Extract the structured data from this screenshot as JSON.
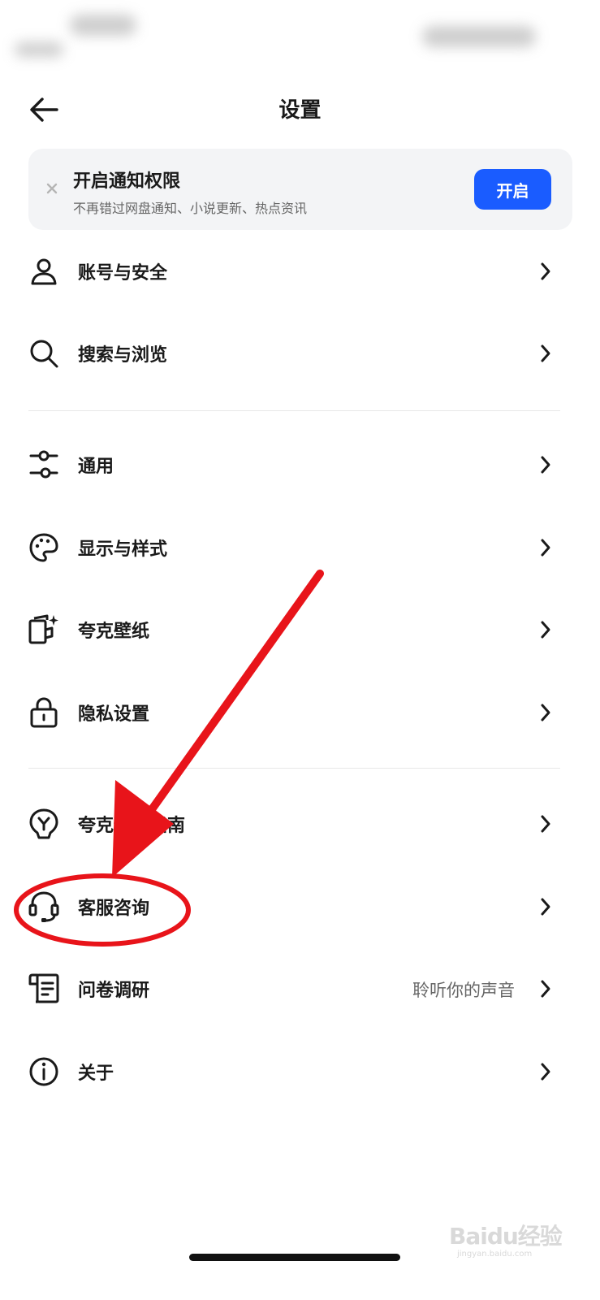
{
  "header": {
    "title": "设置"
  },
  "banner": {
    "title": "开启通知权限",
    "subtitle": "不再错过网盘通知、小说更新、热点资讯",
    "button_label": "开启"
  },
  "sections": [
    {
      "items": [
        {
          "label": "账号与安全",
          "icon": "user-icon"
        },
        {
          "label": "搜索与浏览",
          "icon": "search-icon"
        }
      ]
    },
    {
      "items": [
        {
          "label": "通用",
          "icon": "sliders-icon"
        },
        {
          "label": "显示与样式",
          "icon": "palette-icon"
        },
        {
          "label": "夸克壁纸",
          "icon": "wallpaper-icon"
        },
        {
          "label": "隐私设置",
          "icon": "lock-icon"
        }
      ]
    },
    {
      "items": [
        {
          "label": "夸克使用指南",
          "icon": "bulb-icon"
        },
        {
          "label": "客服咨询",
          "icon": "headset-icon"
        },
        {
          "label": "问卷调研",
          "icon": "survey-icon",
          "extra": "聆听你的声音"
        },
        {
          "label": "关于",
          "icon": "info-icon"
        }
      ]
    }
  ],
  "watermark": {
    "text": "Baidu经验",
    "sub": "jingyan.baidu.com"
  },
  "colors": {
    "accent": "#1a5cff",
    "annotation": "#e8141a",
    "banner_bg": "#f3f4f6"
  }
}
